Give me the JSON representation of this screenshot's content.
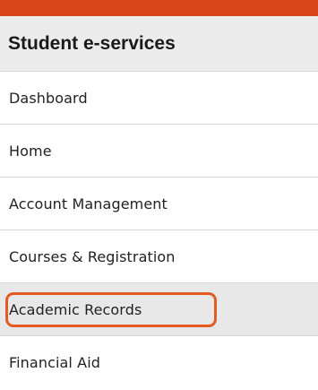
{
  "colors": {
    "accent_bar": "#d9461a",
    "header_bg": "#ececec",
    "highlight_ring": "#e35a24",
    "highlight_bg": "#e8e8e8"
  },
  "header": {
    "title": "Student e-services"
  },
  "nav": {
    "items": [
      {
        "label": "Dashboard"
      },
      {
        "label": "Home"
      },
      {
        "label": "Account Management"
      },
      {
        "label": "Courses & Registration"
      },
      {
        "label": "Academic Records"
      },
      {
        "label": "Financial Aid"
      }
    ]
  }
}
